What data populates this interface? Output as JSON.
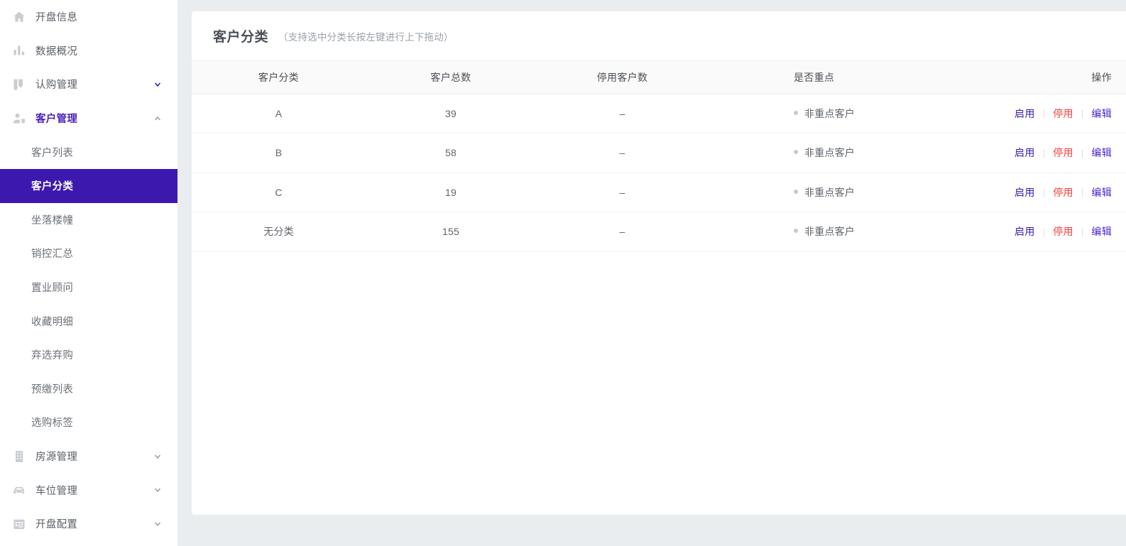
{
  "theme": {
    "accent": "#3d18ae",
    "danger": "#fa3c3c",
    "page_bg": "#e9edf0",
    "card_bg": "#ffffff",
    "header_bg": "#fafafa",
    "muted_text": "#9ba1a8"
  },
  "sidebar": {
    "items": [
      {
        "label": "开盘信息",
        "icon": "home-icon",
        "type": "link",
        "expandable": false
      },
      {
        "label": "数据概况",
        "icon": "bar-chart-icon",
        "type": "link",
        "expandable": false
      },
      {
        "label": "认购管理",
        "icon": "subscription-icon",
        "type": "group",
        "expandable": true,
        "expanded": false,
        "chevron": "chevron-down-icon"
      },
      {
        "label": "客户管理",
        "icon": "customer-icon",
        "type": "group",
        "expandable": true,
        "expanded": true,
        "chevron": "chevron-up-icon"
      }
    ],
    "customer_children": [
      {
        "label": "客户列表",
        "active": false
      },
      {
        "label": "客户分类",
        "active": true
      },
      {
        "label": "坐落楼幢",
        "active": false
      },
      {
        "label": "销控汇总",
        "active": false
      },
      {
        "label": "置业顾问",
        "active": false
      },
      {
        "label": "收藏明细",
        "active": false
      },
      {
        "label": "弃选弃购",
        "active": false
      },
      {
        "label": "预缴列表",
        "active": false
      },
      {
        "label": "选购标签",
        "active": false
      }
    ],
    "bottom_items": [
      {
        "label": "房源管理",
        "icon": "building-icon",
        "chevron": "chevron-down-icon"
      },
      {
        "label": "车位管理",
        "icon": "car-icon",
        "chevron": "chevron-down-icon"
      },
      {
        "label": "开盘配置",
        "icon": "calendar-config-icon",
        "chevron": "chevron-down-icon"
      }
    ]
  },
  "card": {
    "title": "客户分类",
    "subtitle": "（支持选中分类长按左键进行上下拖动）"
  },
  "table": {
    "columns": [
      {
        "key": "category",
        "label": "客户分类"
      },
      {
        "key": "total",
        "label": "客户总数"
      },
      {
        "key": "disabled",
        "label": "停用客户数"
      },
      {
        "key": "is_key",
        "label": "是否重点"
      },
      {
        "key": "actions",
        "label": "操作"
      }
    ],
    "rows": [
      {
        "category": "A",
        "total": "39",
        "disabled": "–",
        "is_key": "非重点客户"
      },
      {
        "category": "B",
        "total": "58",
        "disabled": "–",
        "is_key": "非重点客户"
      },
      {
        "category": "C",
        "total": "19",
        "disabled": "–",
        "is_key": "非重点客户"
      },
      {
        "category": "无分类",
        "total": "155",
        "disabled": "–",
        "is_key": "非重点客户"
      }
    ],
    "actions": {
      "enable": "启用",
      "disable": "停用",
      "edit": "编辑",
      "separator": "|"
    }
  }
}
